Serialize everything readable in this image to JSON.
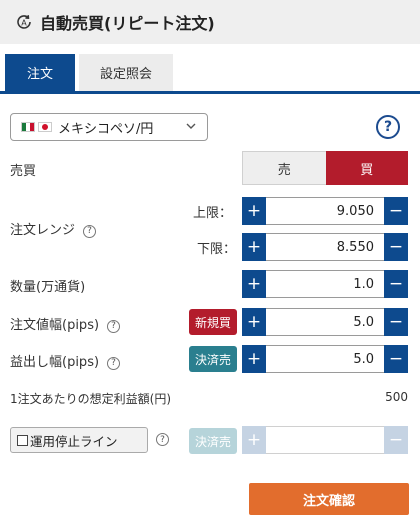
{
  "header": {
    "title": "自動売買(リピート注文)",
    "icon": "repeat-a-icon"
  },
  "tabs": [
    {
      "label": "注文",
      "active": true
    },
    {
      "label": "設定照会",
      "active": false
    }
  ],
  "pair": {
    "label": "メキシコペソ/円",
    "icon_left": "mexico-flag-icon",
    "icon_right": "japan-flag-icon"
  },
  "help_icon": "?",
  "side": {
    "label": "売買",
    "sell": "売",
    "buy": "買",
    "selected": "買"
  },
  "range": {
    "label": "注文レンジ",
    "upper_label": "上限：",
    "lower_label": "下限：",
    "upper_value": "9.050",
    "lower_value": "8.550"
  },
  "quantity": {
    "label": "数量(万通貨)",
    "value": "1.0"
  },
  "order_width": {
    "label": "注文値幅(pips)",
    "badge": "新規買",
    "value": "5.0"
  },
  "profit_width": {
    "label": "益出し幅(pips)",
    "badge": "決済売",
    "value": "5.0"
  },
  "expected_profit": {
    "label": "1注文あたりの想定利益額(円)",
    "value": "500"
  },
  "stop_line": {
    "label": "運用停止ライン",
    "badge": "決済売",
    "value": ""
  },
  "controls": {
    "plus": "+",
    "minus": "−",
    "chevron": "∨"
  },
  "confirm": {
    "label": "注文確認"
  },
  "colors": {
    "primary": "#0d4a8e",
    "buy": "#b31c2c",
    "settle": "#2a7f8f",
    "confirm": "#e26d2d"
  }
}
